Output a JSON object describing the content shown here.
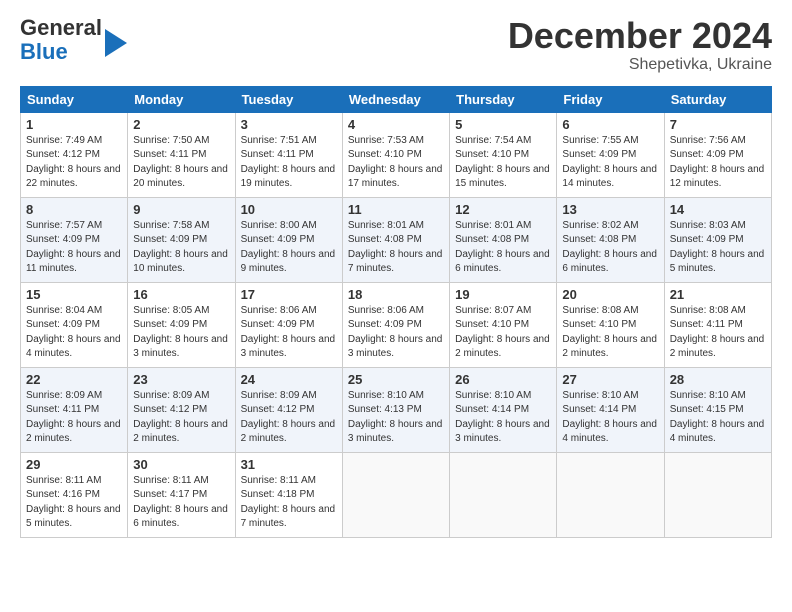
{
  "header": {
    "logo_line1": "General",
    "logo_line2": "Blue",
    "month": "December 2024",
    "location": "Shepetivka, Ukraine"
  },
  "weekdays": [
    "Sunday",
    "Monday",
    "Tuesday",
    "Wednesday",
    "Thursday",
    "Friday",
    "Saturday"
  ],
  "weeks": [
    [
      {
        "day": "1",
        "sunrise": "Sunrise: 7:49 AM",
        "sunset": "Sunset: 4:12 PM",
        "daylight": "Daylight: 8 hours and 22 minutes."
      },
      {
        "day": "2",
        "sunrise": "Sunrise: 7:50 AM",
        "sunset": "Sunset: 4:11 PM",
        "daylight": "Daylight: 8 hours and 20 minutes."
      },
      {
        "day": "3",
        "sunrise": "Sunrise: 7:51 AM",
        "sunset": "Sunset: 4:11 PM",
        "daylight": "Daylight: 8 hours and 19 minutes."
      },
      {
        "day": "4",
        "sunrise": "Sunrise: 7:53 AM",
        "sunset": "Sunset: 4:10 PM",
        "daylight": "Daylight: 8 hours and 17 minutes."
      },
      {
        "day": "5",
        "sunrise": "Sunrise: 7:54 AM",
        "sunset": "Sunset: 4:10 PM",
        "daylight": "Daylight: 8 hours and 15 minutes."
      },
      {
        "day": "6",
        "sunrise": "Sunrise: 7:55 AM",
        "sunset": "Sunset: 4:09 PM",
        "daylight": "Daylight: 8 hours and 14 minutes."
      },
      {
        "day": "7",
        "sunrise": "Sunrise: 7:56 AM",
        "sunset": "Sunset: 4:09 PM",
        "daylight": "Daylight: 8 hours and 12 minutes."
      }
    ],
    [
      {
        "day": "8",
        "sunrise": "Sunrise: 7:57 AM",
        "sunset": "Sunset: 4:09 PM",
        "daylight": "Daylight: 8 hours and 11 minutes."
      },
      {
        "day": "9",
        "sunrise": "Sunrise: 7:58 AM",
        "sunset": "Sunset: 4:09 PM",
        "daylight": "Daylight: 8 hours and 10 minutes."
      },
      {
        "day": "10",
        "sunrise": "Sunrise: 8:00 AM",
        "sunset": "Sunset: 4:09 PM",
        "daylight": "Daylight: 8 hours and 9 minutes."
      },
      {
        "day": "11",
        "sunrise": "Sunrise: 8:01 AM",
        "sunset": "Sunset: 4:08 PM",
        "daylight": "Daylight: 8 hours and 7 minutes."
      },
      {
        "day": "12",
        "sunrise": "Sunrise: 8:01 AM",
        "sunset": "Sunset: 4:08 PM",
        "daylight": "Daylight: 8 hours and 6 minutes."
      },
      {
        "day": "13",
        "sunrise": "Sunrise: 8:02 AM",
        "sunset": "Sunset: 4:08 PM",
        "daylight": "Daylight: 8 hours and 6 minutes."
      },
      {
        "day": "14",
        "sunrise": "Sunrise: 8:03 AM",
        "sunset": "Sunset: 4:09 PM",
        "daylight": "Daylight: 8 hours and 5 minutes."
      }
    ],
    [
      {
        "day": "15",
        "sunrise": "Sunrise: 8:04 AM",
        "sunset": "Sunset: 4:09 PM",
        "daylight": "Daylight: 8 hours and 4 minutes."
      },
      {
        "day": "16",
        "sunrise": "Sunrise: 8:05 AM",
        "sunset": "Sunset: 4:09 PM",
        "daylight": "Daylight: 8 hours and 3 minutes."
      },
      {
        "day": "17",
        "sunrise": "Sunrise: 8:06 AM",
        "sunset": "Sunset: 4:09 PM",
        "daylight": "Daylight: 8 hours and 3 minutes."
      },
      {
        "day": "18",
        "sunrise": "Sunrise: 8:06 AM",
        "sunset": "Sunset: 4:09 PM",
        "daylight": "Daylight: 8 hours and 3 minutes."
      },
      {
        "day": "19",
        "sunrise": "Sunrise: 8:07 AM",
        "sunset": "Sunset: 4:10 PM",
        "daylight": "Daylight: 8 hours and 2 minutes."
      },
      {
        "day": "20",
        "sunrise": "Sunrise: 8:08 AM",
        "sunset": "Sunset: 4:10 PM",
        "daylight": "Daylight: 8 hours and 2 minutes."
      },
      {
        "day": "21",
        "sunrise": "Sunrise: 8:08 AM",
        "sunset": "Sunset: 4:11 PM",
        "daylight": "Daylight: 8 hours and 2 minutes."
      }
    ],
    [
      {
        "day": "22",
        "sunrise": "Sunrise: 8:09 AM",
        "sunset": "Sunset: 4:11 PM",
        "daylight": "Daylight: 8 hours and 2 minutes."
      },
      {
        "day": "23",
        "sunrise": "Sunrise: 8:09 AM",
        "sunset": "Sunset: 4:12 PM",
        "daylight": "Daylight: 8 hours and 2 minutes."
      },
      {
        "day": "24",
        "sunrise": "Sunrise: 8:09 AM",
        "sunset": "Sunset: 4:12 PM",
        "daylight": "Daylight: 8 hours and 2 minutes."
      },
      {
        "day": "25",
        "sunrise": "Sunrise: 8:10 AM",
        "sunset": "Sunset: 4:13 PM",
        "daylight": "Daylight: 8 hours and 3 minutes."
      },
      {
        "day": "26",
        "sunrise": "Sunrise: 8:10 AM",
        "sunset": "Sunset: 4:14 PM",
        "daylight": "Daylight: 8 hours and 3 minutes."
      },
      {
        "day": "27",
        "sunrise": "Sunrise: 8:10 AM",
        "sunset": "Sunset: 4:14 PM",
        "daylight": "Daylight: 8 hours and 4 minutes."
      },
      {
        "day": "28",
        "sunrise": "Sunrise: 8:10 AM",
        "sunset": "Sunset: 4:15 PM",
        "daylight": "Daylight: 8 hours and 4 minutes."
      }
    ],
    [
      {
        "day": "29",
        "sunrise": "Sunrise: 8:11 AM",
        "sunset": "Sunset: 4:16 PM",
        "daylight": "Daylight: 8 hours and 5 minutes."
      },
      {
        "day": "30",
        "sunrise": "Sunrise: 8:11 AM",
        "sunset": "Sunset: 4:17 PM",
        "daylight": "Daylight: 8 hours and 6 minutes."
      },
      {
        "day": "31",
        "sunrise": "Sunrise: 8:11 AM",
        "sunset": "Sunset: 4:18 PM",
        "daylight": "Daylight: 8 hours and 7 minutes."
      },
      null,
      null,
      null,
      null
    ]
  ]
}
